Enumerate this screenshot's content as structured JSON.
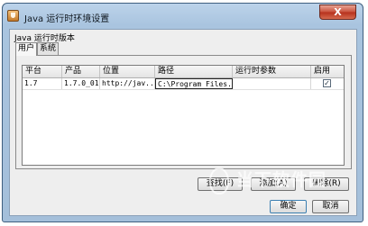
{
  "window": {
    "title": "Java 运行时环境设置",
    "close_label": "X",
    "icon": "java-icon"
  },
  "section_label": "Java 运行时版本",
  "tabs": [
    {
      "label": "用户",
      "active": true
    },
    {
      "label": "系统",
      "active": false
    }
  ],
  "table": {
    "columns": [
      "平台",
      "产品",
      "位置",
      "路径",
      "运行时参数",
      "启用"
    ],
    "rows": [
      {
        "platform": "1.7",
        "product": "1.7.0_01",
        "location": "http://jav...",
        "path": "C:\\Program Files...",
        "params": "",
        "enabled": true
      }
    ]
  },
  "buttons": {
    "find": "查找(F)",
    "add": "添加(A)",
    "remove": "删除(R)",
    "ok": "确定",
    "cancel": "取消"
  },
  "watermark": {
    "text": "当下软件园"
  }
}
